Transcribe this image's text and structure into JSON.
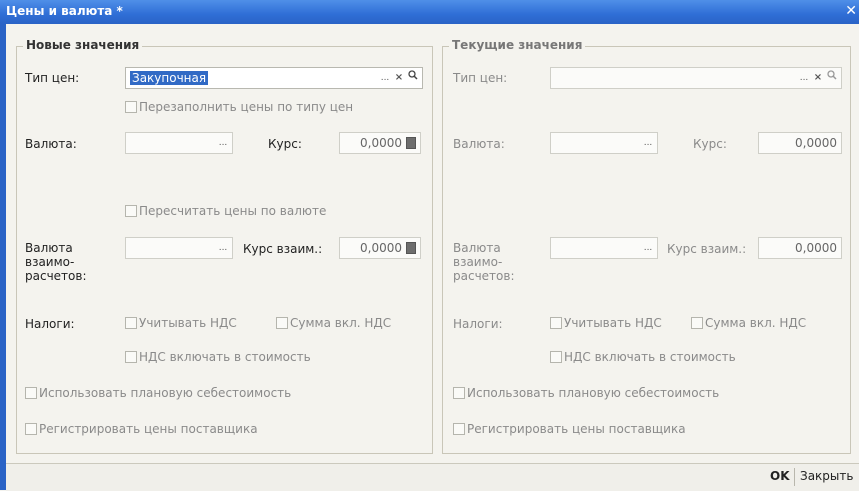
{
  "window": {
    "title": "Цены и валюта *",
    "close_glyph": "✕"
  },
  "new_values": {
    "legend": "Новые значения",
    "price_type_label": "Тип цен:",
    "price_type_value": "Закупочная",
    "refill_prices_label": "Перезаполнить цены по типу цен",
    "currency_label": "Валюта:",
    "currency_value": "",
    "rate_label": "Курс:",
    "rate_value": "0,0000",
    "recalc_label": "Пересчитать цены по валюте",
    "settlement_currency_label": "Валюта взаимо-расчетов:",
    "settlement_rate_label": "Курс взаим.:",
    "settlement_rate_value": "0,0000",
    "taxes_label": "Налоги:",
    "vat_consider_label": "Учитывать НДС",
    "vat_included_label": "Сумма вкл. НДС",
    "vat_in_cost_label": "НДС включать в стоимость",
    "planned_cost_label": "Использовать плановую себестоимость",
    "register_prices_label": "Регистрировать цены поставщика"
  },
  "current_values": {
    "legend": "Текущие значения",
    "price_type_label": "Тип цен:",
    "price_type_value": "",
    "currency_label": "Валюта:",
    "rate_label": "Курс:",
    "rate_value": "0,0000",
    "settlement_currency_label": "Валюта взаимо-расчетов:",
    "settlement_rate_label": "Курс взаим.:",
    "settlement_rate_value": "0,0000",
    "taxes_label": "Налоги:",
    "vat_consider_label": "Учитывать НДС",
    "vat_included_label": "Сумма вкл. НДС",
    "vat_in_cost_label": "НДС включать в стоимость",
    "planned_cost_label": "Использовать плановую себестоимость",
    "register_prices_label": "Регистрировать цены поставщика"
  },
  "buttons": {
    "ok": "OK",
    "close": "Закрыть"
  },
  "icons": {
    "select": "...",
    "clear": "×",
    "search": "🔍",
    "calculator": "calculator-icon"
  }
}
